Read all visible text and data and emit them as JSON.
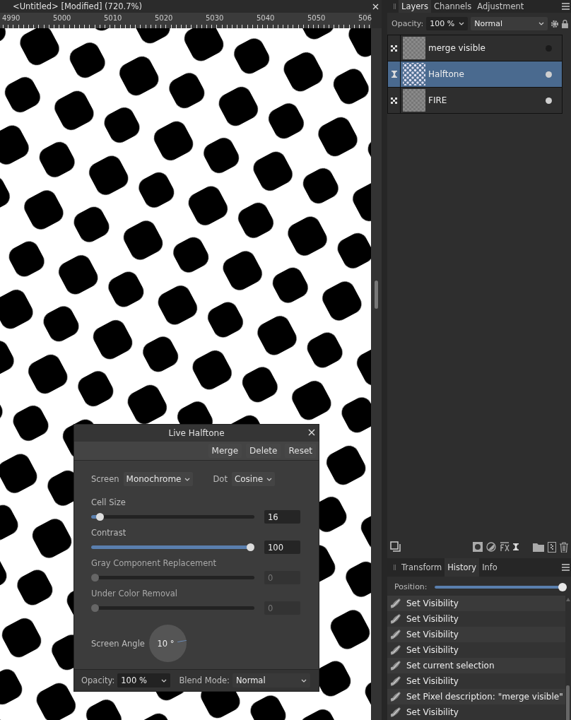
{
  "document_tab": {
    "title": "<Untitled> [Modified] (720.7%)"
  },
  "ruler": {
    "labels": [
      "4990",
      "5000",
      "5010",
      "5020",
      "5030",
      "5040",
      "5050",
      "506"
    ]
  },
  "live_halftone": {
    "title": "Live Halftone",
    "buttons": [
      "Merge",
      "Delete",
      "Reset"
    ],
    "screen": {
      "label": "Screen",
      "value": "Monochrome"
    },
    "dot": {
      "label": "Dot",
      "value": "Cosine"
    },
    "sliders": [
      {
        "label": "Cell Size",
        "level": 0.03,
        "value": "16",
        "disabled": false
      },
      {
        "label": "Contrast",
        "level": 1,
        "value": "100",
        "disabled": false
      },
      {
        "label": "Gray Component Replacement",
        "level": 0,
        "value": "0",
        "disabled": true
      },
      {
        "label": "Under Color Removal",
        "level": 0,
        "value": "0",
        "disabled": true
      }
    ],
    "screen_angle": {
      "label": "Screen Angle",
      "value": "10 °"
    },
    "opacity": {
      "label": "Opacity:",
      "value": "100 %"
    },
    "blend_mode": {
      "label": "Blend Mode:",
      "value": "Normal"
    }
  },
  "layers_panel": {
    "tabs": [
      {
        "label": "Layers",
        "selected": true
      },
      {
        "label": "Channels",
        "selected": false
      },
      {
        "label": "Adjustment",
        "selected": false
      }
    ],
    "opacity": {
      "label": "Opacity:",
      "value": "100 %"
    },
    "blend_mode": {
      "value": "Normal"
    },
    "layers": [
      {
        "name": "merge visible",
        "kind": "pixel",
        "selected": false,
        "visible": false
      },
      {
        "name": "Halftone",
        "kind": "live-filter",
        "selected": true,
        "visible": true
      },
      {
        "name": "FIRE",
        "kind": "pixel",
        "selected": false,
        "visible": true
      }
    ]
  },
  "history_panel": {
    "tabs": [
      {
        "label": "Transform",
        "selected": false
      },
      {
        "label": "History",
        "selected": true
      },
      {
        "label": "Info",
        "selected": false
      }
    ],
    "position": {
      "label": "Position:",
      "level": 1
    },
    "entries": [
      "Set Visibility",
      "Set Visibility",
      "Set Visibility",
      "Set Visibility",
      "Set current selection",
      "Set Visibility",
      "Set Pixel description: \"merge visible\"",
      "Set Visibility"
    ]
  }
}
